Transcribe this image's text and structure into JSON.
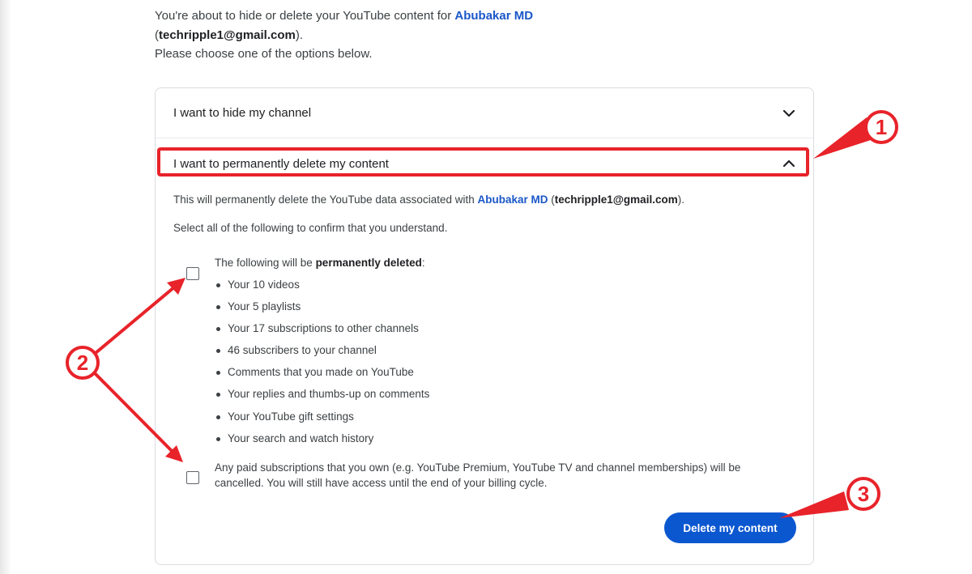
{
  "intro": {
    "line1_prefix": "You're about to hide or delete your YouTube content for ",
    "account_name": "Abubakar MD",
    "line2_open": "(",
    "email": "techripple1@gmail.com",
    "line2_close": ").",
    "line3": "Please choose one of the options below."
  },
  "accordion": {
    "hide_label": "I want to hide my channel",
    "delete_label": "I want to permanently delete my content"
  },
  "delete_panel": {
    "info_prefix": "This will permanently delete the YouTube data associated with ",
    "account_name": "Abubakar MD",
    "info_email_open": " (",
    "email": "techripple1@gmail.com",
    "info_close": ").",
    "confirm_text": "Select all of the following to confirm that you understand.",
    "list_head_prefix": "The following will be ",
    "list_head_bold": "permanently deleted",
    "list_head_suffix": ":",
    "items": [
      "Your 10 videos",
      "Your 5 playlists",
      "Your 17 subscriptions to other channels",
      "46 subscribers to your channel",
      "Comments that you made on YouTube",
      "Your replies and thumbs-up on comments",
      "Your YouTube gift settings",
      "Your search and watch history"
    ],
    "paid_text": "Any paid subscriptions that you own (e.g. YouTube Premium, YouTube TV and channel memberships) will be cancelled. You will still have access until the end of your billing cycle.",
    "delete_button": "Delete my content"
  },
  "annotations": {
    "badge1": "1",
    "badge2": "2",
    "badge3": "3",
    "accent_color": "#e8232a"
  },
  "colors": {
    "link": "#1a57c8",
    "button": "#0b57d0"
  }
}
